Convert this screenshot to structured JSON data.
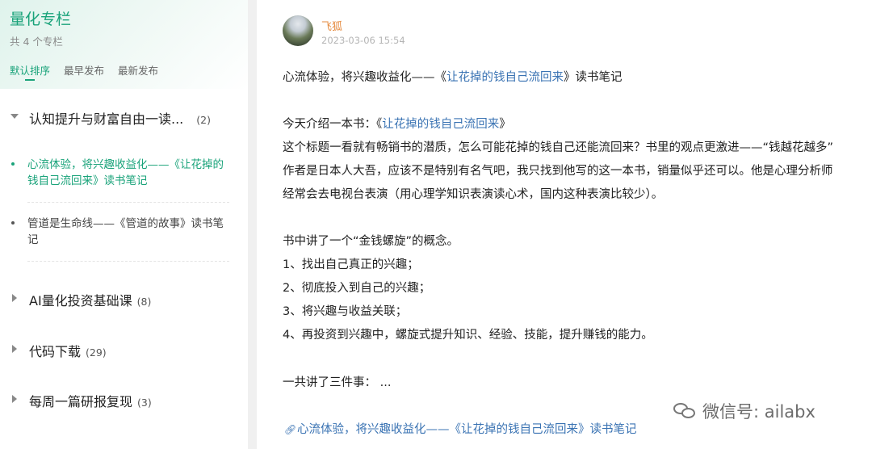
{
  "sidebar": {
    "title": "量化专栏",
    "count_text": "共 4 个专栏",
    "sort_tabs": [
      {
        "label": "默认排序",
        "active": true
      },
      {
        "label": "最早发布",
        "active": false
      },
      {
        "label": "最新发布",
        "active": false
      }
    ],
    "groups": [
      {
        "label": "认知提升与财富自由一读...",
        "count": "(2)",
        "expanded": true,
        "articles": [
          {
            "title": "心流体验，将兴趣收益化——《让花掉的钱自己流回来》读书笔记",
            "active": true
          },
          {
            "title": "管道是生命线——《管道的故事》读书笔记",
            "active": false
          }
        ]
      },
      {
        "label": "AI量化投资基础课",
        "count": "(8)",
        "expanded": false
      },
      {
        "label": "代码下载",
        "count": "(29)",
        "expanded": false
      },
      {
        "label": "每周一篇研报复现",
        "count": "(3)",
        "expanded": false
      }
    ]
  },
  "post": {
    "author": "飞狐",
    "date": "2023-03-06 15:54",
    "heading_prefix": "心流体验，将兴趣收益化——《",
    "heading_link": "让花掉的钱自己流回来",
    "heading_suffix": "》读书笔记",
    "intro_prefix": "今天介绍一本书：《",
    "intro_link": "让花掉的钱自己流回来",
    "intro_suffix": "》",
    "p1": "这个标题一看就有畅销书的潜质，怎么可能花掉的钱自己还能流回来？书里的观点更激进——“钱越花越多”",
    "p2": "作者是日本人大吾，应该不是特别有名气吧，我只找到他写的这一本书，销量似乎还可以。他是心理分析师",
    "p3": "经常会去电视台表演（用心理学知识表演读心术，国内这种表演比较少）。",
    "p4": "书中讲了一个“金钱螺旋”的概念。",
    "list": [
      "1、找出自己真正的兴趣；",
      "2、彻底投入到自己的兴趣；",
      "3、将兴趣与收益关联；",
      "4、再投资到兴趣中，螺旋式提升知识、经验、技能，提升赚钱的能力。"
    ],
    "p5": "一共讲了三件事：  ...",
    "footer_link": "心流体验，将兴趣收益化——《让花掉的钱自己流回来》读书笔记"
  },
  "watermark": "微信号: ailabx",
  "colors": {
    "accent": "#1aa37a",
    "link": "#3a73b3",
    "author": "#e58a3e"
  }
}
